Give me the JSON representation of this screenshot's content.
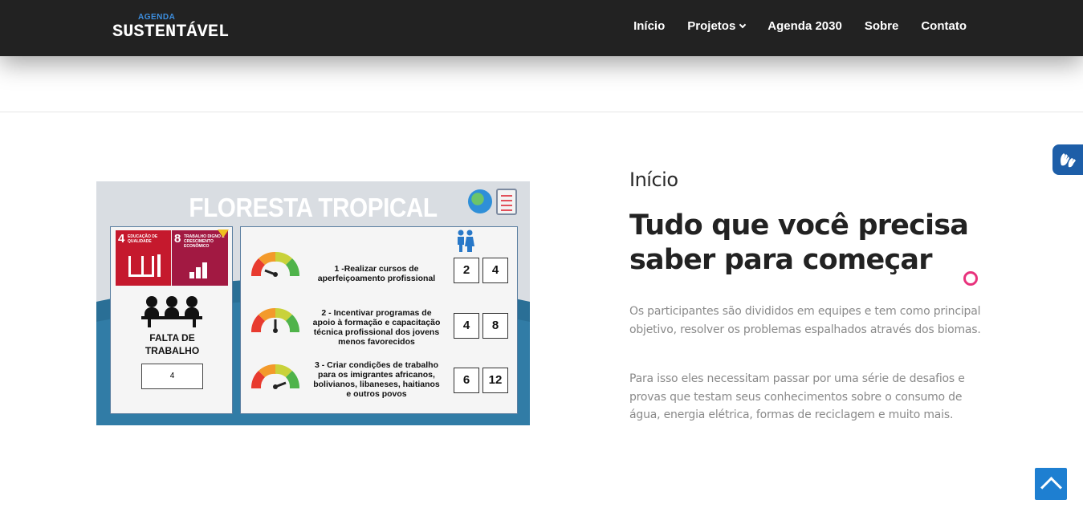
{
  "header": {
    "logo_small": "AGENDA",
    "logo_main": "SUSTENTÁVEL",
    "nav": [
      {
        "label": "Início"
      },
      {
        "label": "Projetos"
      },
      {
        "label": "Agenda 2030"
      },
      {
        "label": "Sobre"
      },
      {
        "label": "Contato"
      }
    ]
  },
  "infographic": {
    "title": "FLORESTA TROPICAL",
    "sdg4": {
      "number": "4",
      "text": "EDUCAÇÃO DE QUALIDADE",
      "color": "#c5192d"
    },
    "sdg8": {
      "number": "8",
      "text": "TRABALHO DIGNO E CRESCIMENTO ECONÔMICO",
      "color": "#a21942"
    },
    "problem_label_line1": "FALTA DE",
    "problem_label_line2": "TRABALHO",
    "problem_value": "4",
    "actions": [
      {
        "lines": [
          "1 -Realizar cursos de",
          "aperfeiçoamento profissional"
        ],
        "a": "2",
        "b": "4"
      },
      {
        "lines": [
          "2 -  Incentivar programas de",
          "apoio à formação e capacitação",
          "técnica profissional dos jovens",
          "menos favorecidos"
        ],
        "a": "4",
        "b": "8"
      },
      {
        "lines": [
          "3 - Criar condições de trabalho",
          "para os imigrantes africanos,",
          "bolivianos, libaneses, haitianos",
          "e outros povos"
        ],
        "a": "6",
        "b": "12"
      }
    ]
  },
  "content": {
    "kicker": "Início",
    "headline_line1": "Tudo que você precisa",
    "headline_line2": "saber para começar",
    "paragraph1": "Os participantes são divididos em equipes e tem como principal objetivo, resolver os problemas espalhados através dos biomas.",
    "paragraph2": "Para isso eles necessitam passar por uma série de desafios e provas que testam seus conhecimentos sobre o consumo de água, energia elétrica, formas de reciclagem e muito mais."
  },
  "colors": {
    "header_bg": "#222222",
    "accent_blue": "#1e7fd1",
    "ring_pink": "#e8327c"
  },
  "icons": {
    "accessibility": "vlibras-hands-icon",
    "back_to_top": "chevron-up-icon"
  }
}
